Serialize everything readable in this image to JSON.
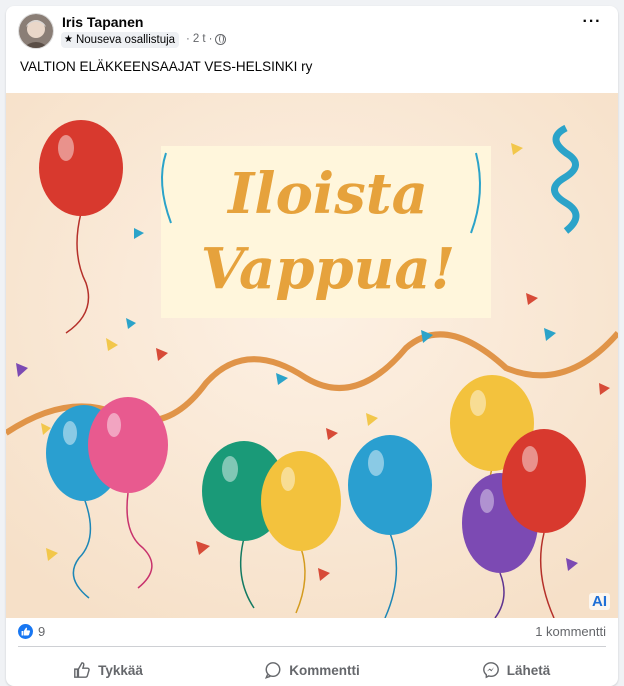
{
  "post": {
    "author": "Iris Tapanen",
    "badge": "Nousev­a osallistuja",
    "time": "2 t",
    "separator": "·",
    "more": "···",
    "text": "VALTION ELÄKKEENSAAJAT VES-HELSINKI ry"
  },
  "image": {
    "line1": "Iloista",
    "line2": "Vappua!",
    "ai_label": "AI"
  },
  "stats": {
    "reaction_count": "9",
    "comments": "1 kommentti"
  },
  "actions": {
    "like": "Tykkää",
    "comment": "Kommentti",
    "share": "Lähetä"
  },
  "colors": {
    "brand": "#1877f2",
    "secondary_text": "#65676b",
    "title_gold": "#e6a23c",
    "image_bg": "#fbe9d6"
  },
  "icons": [
    "star-icon",
    "globe-icon",
    "more-icon",
    "like-reaction-icon",
    "thumbs-up-icon",
    "comment-icon",
    "messenger-icon"
  ]
}
